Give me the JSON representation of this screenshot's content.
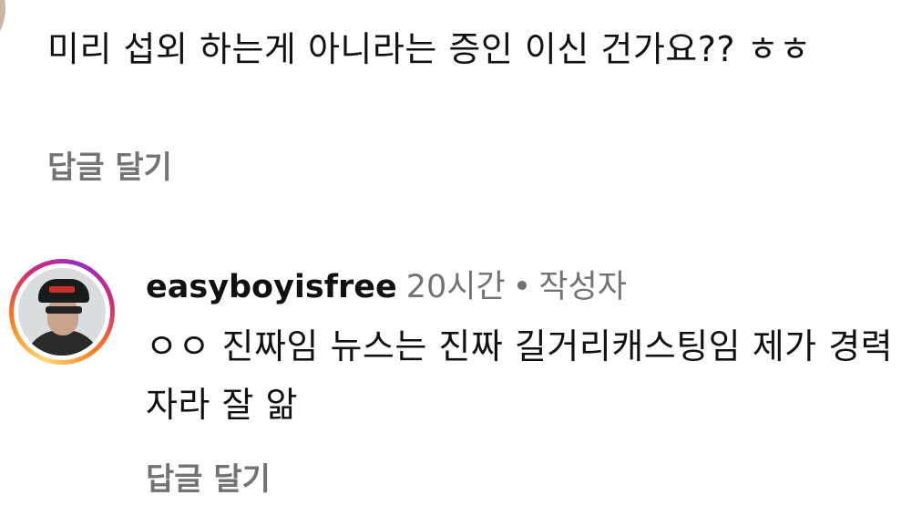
{
  "comment1": {
    "text": "미리 섭외 하는게 아니라는 증인 이신 건가요?? ㅎㅎ",
    "reply_label": "답글 달기"
  },
  "comment2": {
    "username": "easyboyisfree",
    "time": "20시간",
    "separator": "•",
    "author_badge": "작성자",
    "text": "ㅇㅇ 진짜임 뉴스는 진짜 길거리캐스팅임 제가 경력자라 잘 앎",
    "reply_label": "답글 달기",
    "avatar_ring_colors": [
      "#feda75",
      "#fa7e1e",
      "#d62976",
      "#962fbf"
    ]
  }
}
